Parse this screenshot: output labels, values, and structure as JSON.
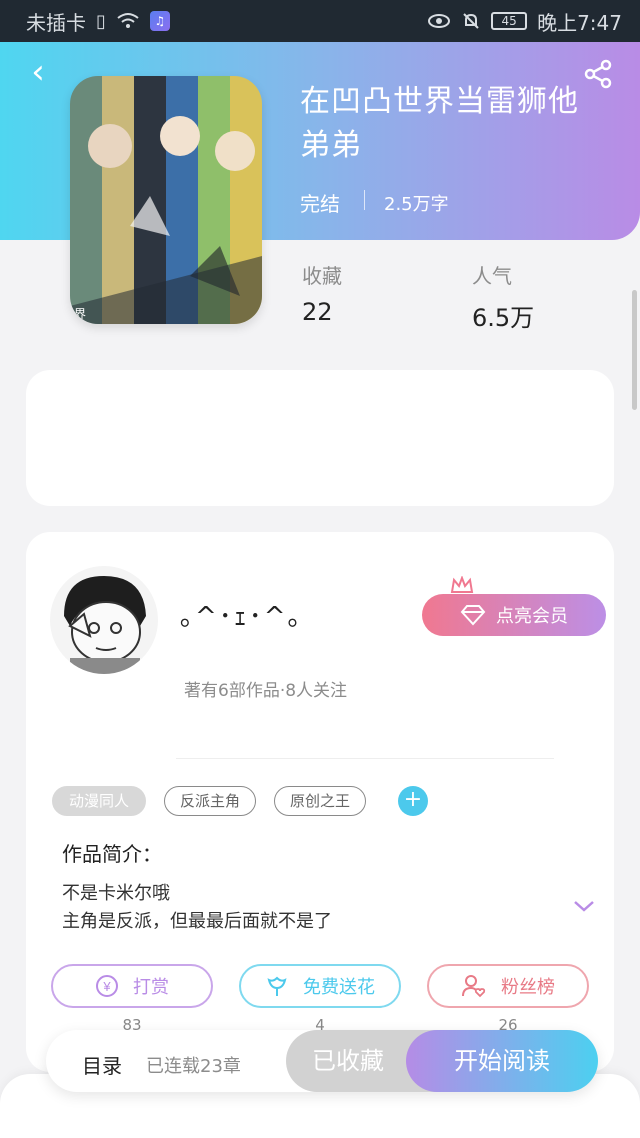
{
  "status_bar": {
    "carrier": "未插卡",
    "battery": "45",
    "time": "晚上7:47"
  },
  "book": {
    "title": "在凹凸世界当雷狮他弟弟",
    "status": "完结",
    "word_count": "2.5万字",
    "stats": [
      {
        "label": "收藏",
        "value": "22"
      },
      {
        "label": "人气",
        "value": "6.5万"
      }
    ],
    "cover_mark": "界"
  },
  "author": {
    "name": "｡^･ｪ･^｡",
    "meta": "著有6部作品·8人关注",
    "member_button": "点亮会员"
  },
  "tags": [
    "动漫同人",
    "反派主角",
    "原创之王"
  ],
  "intro": {
    "label": "作品简介：",
    "lines": [
      "不是卡米尔哦",
      "主角是反派，但最最后面就不是了"
    ]
  },
  "actions": [
    {
      "label": "打赏",
      "count": "83",
      "color": "#b98ce6"
    },
    {
      "label": "免费送花",
      "count": "4",
      "color": "#4cc9ec"
    },
    {
      "label": "粉丝榜",
      "count": "26",
      "color": "#e87a86"
    }
  ],
  "bottom_bar": {
    "toc_label": "目录",
    "toc_info": "已连载23章",
    "collected": "已收藏",
    "read": "开始阅读"
  },
  "colors": {
    "header_start": "#4fd6f0",
    "header_end": "#b98ce6",
    "accent": "#4cc9ec"
  }
}
